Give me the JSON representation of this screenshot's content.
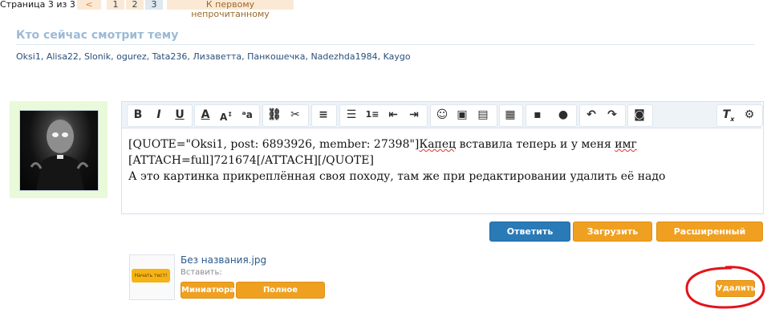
{
  "pagination": {
    "label": "Страница 3 из 3",
    "prev": "<",
    "pages": [
      "1",
      "2",
      "3"
    ],
    "current": "3",
    "first_unread": "К первому непрочитанному"
  },
  "viewers": {
    "title": "Кто сейчас смотрит тему",
    "users": [
      "Oksi1",
      "Alisa22",
      "Slonik",
      "ogurez",
      "Tata236",
      "Лизаветта",
      "Панкошечка",
      "Nadezhda1984",
      "Kaygo"
    ]
  },
  "toolbar": {
    "icons": [
      "bold-icon",
      "italic-icon",
      "underline-icon",
      "text-color-icon",
      "font-size-icon",
      "font-family-icon",
      "link-icon",
      "unlink-icon",
      "align-icon",
      "bullet-list-icon",
      "numbered-list-icon",
      "outdent-icon",
      "indent-icon",
      "smilies-icon",
      "image-icon",
      "media-icon",
      "quote-icon",
      "save-draft-icon",
      "user-icon",
      "undo-icon",
      "redo-icon",
      "camera-icon",
      "remove-format-icon",
      "bbcode-toggle-icon"
    ]
  },
  "editor": {
    "line1_prefix": "[QUOTE=\"Oksi1, post: 6893926, member: 27398\"]",
    "line1_misspelled": "Капец",
    "line1_suffix": " вставила теперь и у меня ",
    "line1_misspelled2": "имг",
    "line2": "[ATTACH=full]721674[/ATTACH][/QUOTE]",
    "line3": "А это картинка прикреплённая своя походу, там же при редактировании удалить её надо"
  },
  "actions": {
    "reply": "Ответить",
    "upload": "Загрузить файл",
    "advanced": "Расширенный режим..."
  },
  "attachment": {
    "filename": "Без названия.jpg",
    "thumb_text": "Начать тест!",
    "insert_label": "Вставить:",
    "thumbnail_btn": "Миниатюра",
    "full_btn": "Полное изображение",
    "delete_btn": "Удалить"
  },
  "colors": {
    "accent_blue": "#2a7ab8",
    "accent_orange": "#f0a020",
    "annotation_red": "#e3131b"
  }
}
